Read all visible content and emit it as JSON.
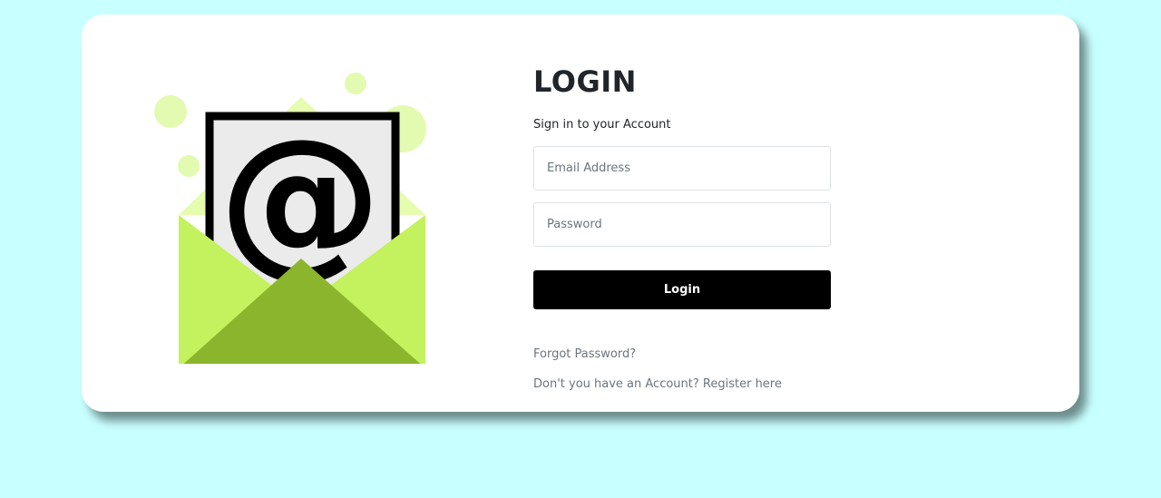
{
  "login": {
    "title": "LOGIN",
    "subtitle": "Sign in to your Account",
    "email_placeholder": "Email Address",
    "password_placeholder": "Password",
    "login_label": "Login",
    "forgot_label": "Forgot Password?",
    "register_label": "Don't you have an Account? Register here"
  },
  "illustration": {
    "icon": "envelope-at-icon",
    "colors": {
      "circles": "#e3fbb0",
      "flap": "#e6fcae",
      "envelope": "#c3f25e",
      "envelope_front": "#8bb52c",
      "paper": "#ebebeb",
      "ink": "#000000"
    }
  },
  "theme": {
    "background": "#c8ffff",
    "card": "#ffffff",
    "button": "#000000"
  }
}
